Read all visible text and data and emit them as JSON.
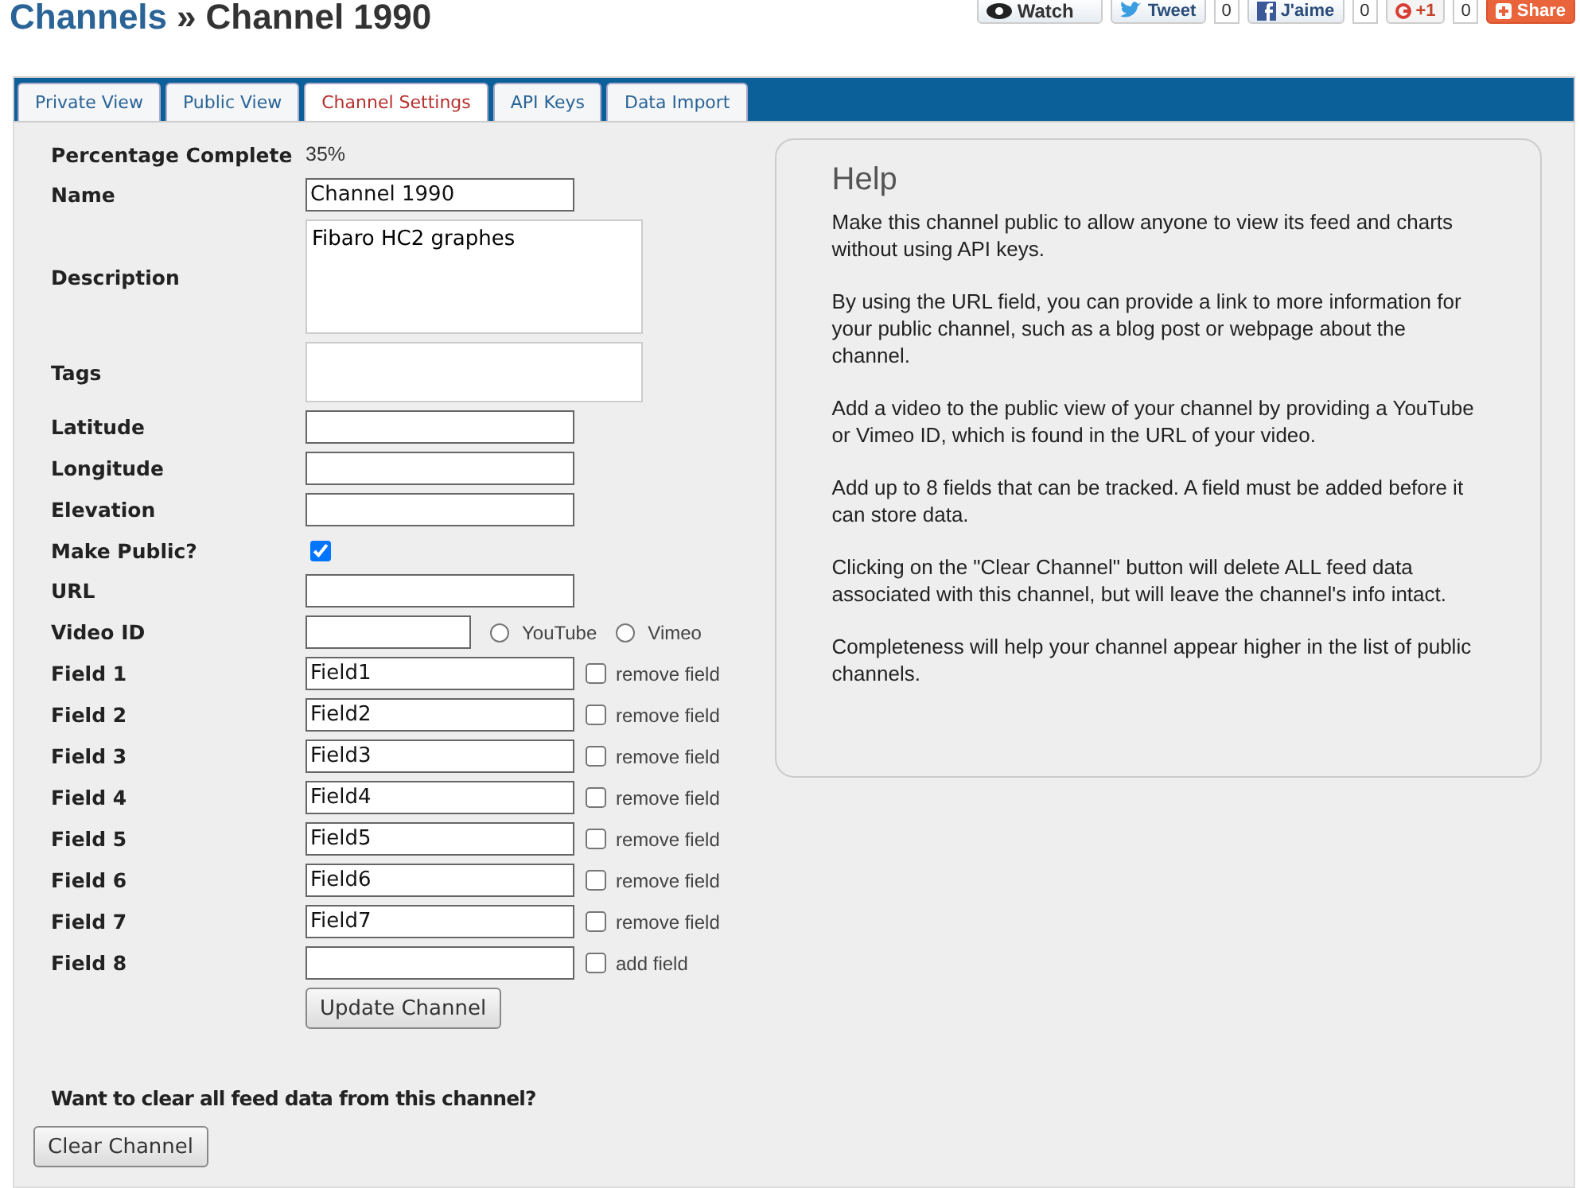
{
  "header": {
    "section": "Channels",
    "separator": "»",
    "page": "Channel 1990"
  },
  "social": [
    {
      "kind": "watch",
      "label": "Watch"
    },
    {
      "kind": "tweet",
      "label": "Tweet",
      "count": "0"
    },
    {
      "kind": "like",
      "label": "J'aime",
      "count": "0"
    },
    {
      "kind": "plusone",
      "label": "+1",
      "count": "0"
    },
    {
      "kind": "share",
      "label": "Share"
    }
  ],
  "tabs": [
    {
      "label": "Private View",
      "selected": false
    },
    {
      "label": "Public View",
      "selected": false
    },
    {
      "label": "Channel Settings",
      "selected": true
    },
    {
      "label": "API Keys",
      "selected": false
    },
    {
      "label": "Data Import",
      "selected": false
    }
  ],
  "form": [
    {
      "kind": "readout",
      "label": "Percentage Complete",
      "value": "35%"
    },
    {
      "kind": "text",
      "label": "Name",
      "value": "Channel 1990"
    },
    {
      "kind": "textarea",
      "label": "Description",
      "value": "Fibaro HC2 graphes"
    },
    {
      "kind": "tags",
      "label": "Tags"
    },
    {
      "kind": "text",
      "label": "Latitude"
    },
    {
      "kind": "text",
      "label": "Longitude"
    },
    {
      "kind": "text",
      "label": "Elevation"
    },
    {
      "kind": "checkbox",
      "label": "Make Public?",
      "checked": true
    },
    {
      "kind": "text",
      "label": "URL"
    },
    {
      "kind": "video",
      "label": "Video ID",
      "options": [
        {
          "label": "YouTube",
          "selected": false
        },
        {
          "label": "Vimeo",
          "selected": false
        }
      ]
    },
    {
      "kind": "field",
      "label": "Field 1",
      "value": "Field1",
      "option": "remove field",
      "checked": false
    },
    {
      "kind": "field",
      "label": "Field 2",
      "value": "Field2",
      "option": "remove field",
      "checked": false
    },
    {
      "kind": "field",
      "label": "Field 3",
      "value": "Field3",
      "option": "remove field",
      "checked": false
    },
    {
      "kind": "field",
      "label": "Field 4",
      "value": "Field4",
      "option": "remove field",
      "checked": false
    },
    {
      "kind": "field",
      "label": "Field 5",
      "value": "Field5",
      "option": "remove field",
      "checked": false
    },
    {
      "kind": "field",
      "label": "Field 6",
      "value": "Field6",
      "option": "remove field",
      "checked": false
    },
    {
      "kind": "field",
      "label": "Field 7",
      "value": "Field7",
      "option": "remove field",
      "checked": false
    },
    {
      "kind": "field",
      "label": "Field 8",
      "option": "add field",
      "checked": false
    }
  ],
  "update_button": "Update Channel",
  "clear_question": "Want to clear all feed data from this channel?",
  "clear_button": "Clear Channel",
  "help": {
    "title": "Help",
    "paragraphs": [
      "Make this channel public to allow anyone to view its feed and charts without using API keys.",
      "By using the URL field, you can provide a link to more information for your public channel, such as a blog post or webpage about the channel.",
      "Add a video to the public view of your channel by providing a YouTube or Vimeo ID, which is found in the URL of your video.",
      "Add up to 8 fields that can be tracked. A field must be added before it can store data.",
      "Clicking on the \"Clear Channel\" button will delete ALL feed data associated with this channel, but will leave the channel's info intact.",
      "Completeness will help your channel appear higher in the list of public channels."
    ]
  }
}
